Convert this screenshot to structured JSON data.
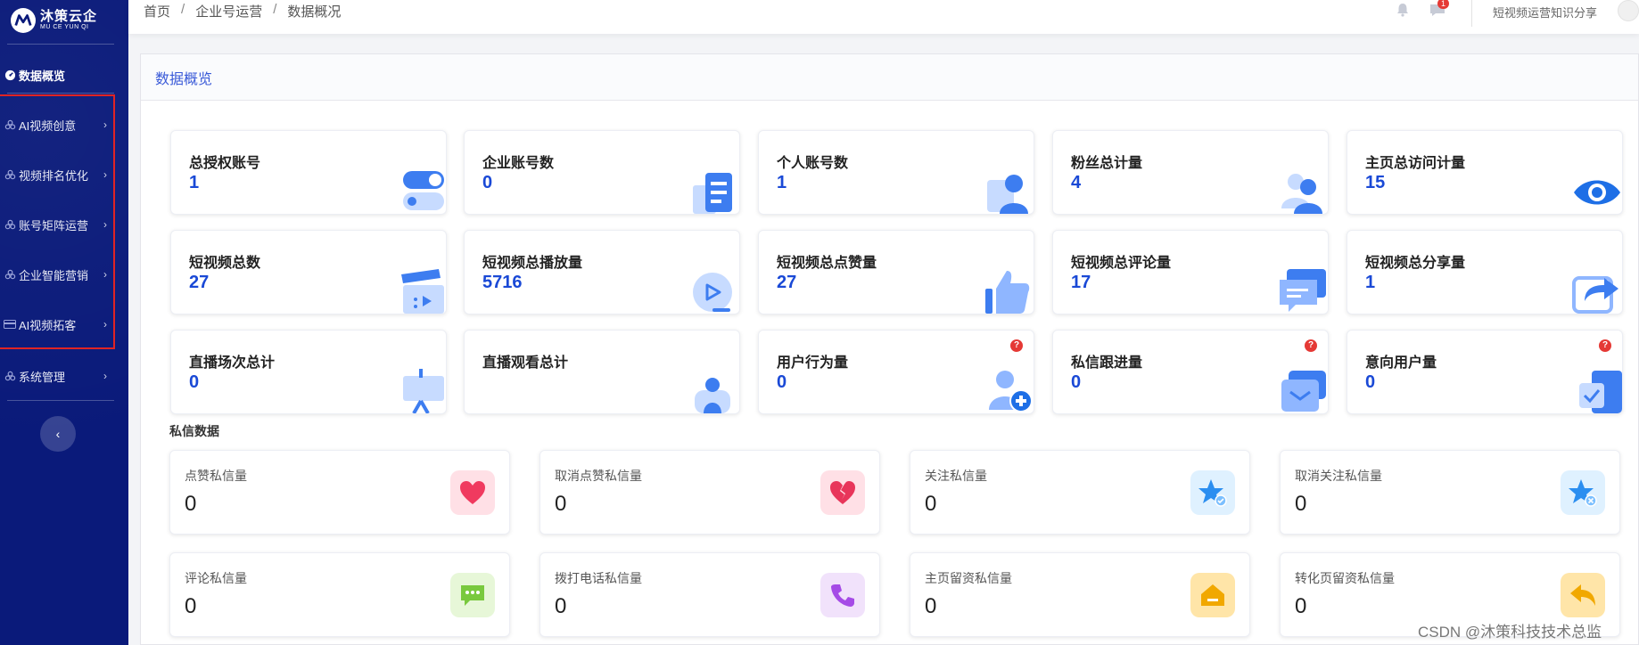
{
  "brand": {
    "name_cn": "沐策云企",
    "name_en": "MU CE YUN QI"
  },
  "sidebar": {
    "items": [
      {
        "label": "数据概览",
        "icon": "dashboard-icon",
        "active": true
      },
      {
        "label": "AI视频创意",
        "icon": "grid-icon"
      },
      {
        "label": "视频排名优化",
        "icon": "grid-icon"
      },
      {
        "label": "账号矩阵运营",
        "icon": "grid-icon"
      },
      {
        "label": "企业智能营销",
        "icon": "grid-icon"
      },
      {
        "label": "AI视频拓客",
        "icon": "card-icon"
      },
      {
        "label": "系统管理",
        "icon": "grid-icon"
      }
    ],
    "collapse_glyph": "‹"
  },
  "header": {
    "breadcrumb": [
      "首页",
      "企业号运营",
      "数据概况"
    ],
    "message_badge": "1",
    "user_name": "短视频运营知识分享"
  },
  "panel": {
    "title": "数据概览"
  },
  "stats": [
    {
      "label": "总授权账号",
      "value": "1",
      "icon": "toggle-icon"
    },
    {
      "label": "企业账号数",
      "value": "0",
      "icon": "document-icon"
    },
    {
      "label": "个人账号数",
      "value": "1",
      "icon": "person-icon"
    },
    {
      "label": "粉丝总计量",
      "value": "4",
      "icon": "users-icon"
    },
    {
      "label": "主页总访问计量",
      "value": "15",
      "icon": "eye-icon"
    },
    {
      "label": "短视频总数",
      "value": "27",
      "icon": "clapperboard-icon"
    },
    {
      "label": "短视频总播放量",
      "value": "5716",
      "icon": "play-icon"
    },
    {
      "label": "短视频总点赞量",
      "value": "27",
      "icon": "thumbs-up-icon"
    },
    {
      "label": "短视频总评论量",
      "value": "17",
      "icon": "comment-icon"
    },
    {
      "label": "短视频总分享量",
      "value": "1",
      "icon": "share-icon"
    },
    {
      "label": "直播场次总计",
      "value": "0",
      "icon": "easel-icon"
    },
    {
      "label": "直播观看总计",
      "value": "",
      "icon": "viewer-icon"
    },
    {
      "label": "用户行为量",
      "value": "0",
      "icon": "add-user-icon",
      "help": "?"
    },
    {
      "label": "私信跟进量",
      "value": "0",
      "icon": "mail-icon",
      "help": "?"
    },
    {
      "label": "意向用户量",
      "value": "0",
      "icon": "checkbox-icon",
      "help": "?"
    }
  ],
  "private_messages": {
    "title": "私信数据",
    "items": [
      {
        "label": "点赞私信量",
        "value": "0",
        "icon": "heart-icon"
      },
      {
        "label": "取消点赞私信量",
        "value": "0",
        "icon": "broken-heart-icon"
      },
      {
        "label": "关注私信量",
        "value": "0",
        "icon": "star-check-icon"
      },
      {
        "label": "取消关注私信量",
        "value": "0",
        "icon": "star-cancel-icon"
      },
      {
        "label": "评论私信量",
        "value": "0",
        "icon": "chat-icon"
      },
      {
        "label": "拨打电话私信量",
        "value": "0",
        "icon": "phone-icon"
      },
      {
        "label": "主页留资私信量",
        "value": "0",
        "icon": "home-icon"
      },
      {
        "label": "转化页留资私信量",
        "value": "0",
        "icon": "back-arrow-icon"
      }
    ]
  },
  "watermark": "CSDN @沐策科技技术总监",
  "colors": {
    "sidebar_bg": "#0a1a7a",
    "accent": "#1a49d6",
    "highlight_border": "#e02424"
  }
}
